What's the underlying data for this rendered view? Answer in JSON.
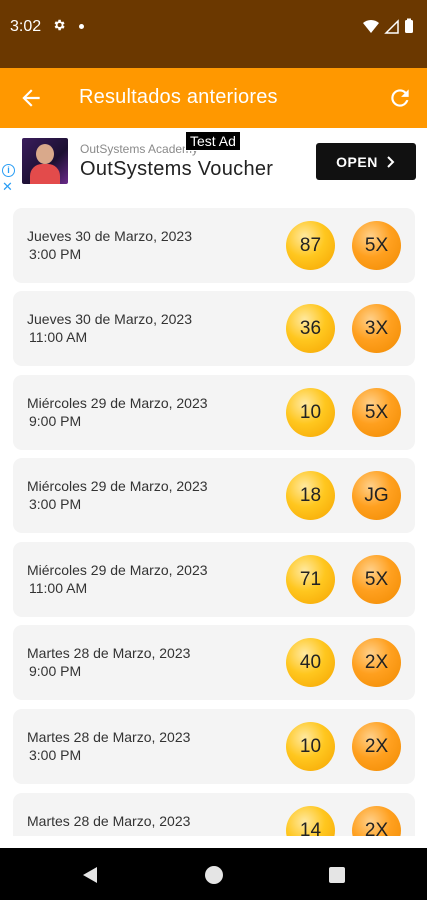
{
  "status_bar": {
    "time": "3:02",
    "icons": [
      "gear-icon",
      "notification-dot-icon",
      "wifi-icon",
      "signal-icon",
      "battery-icon"
    ]
  },
  "app_bar": {
    "title": "Resultados anteriores",
    "back_icon": "arrow-left-icon",
    "refresh_icon": "refresh-icon"
  },
  "ad": {
    "label": "Test Ad",
    "advertiser": "OutSystems Academy",
    "headline": "OutSystems Voucher",
    "cta": "OPEN",
    "cta_icon": "chevron-right-icon"
  },
  "results": [
    {
      "date": "Jueves 30 de Marzo, 2023",
      "time": "3:00 PM",
      "number": "87",
      "multiplier": "5X"
    },
    {
      "date": "Jueves 30 de Marzo, 2023",
      "time": "11:00 AM",
      "number": "36",
      "multiplier": "3X"
    },
    {
      "date": "Miércoles 29 de Marzo, 2023",
      "time": "9:00 PM",
      "number": "10",
      "multiplier": "5X"
    },
    {
      "date": "Miércoles 29 de Marzo, 2023",
      "time": "3:00 PM",
      "number": "18",
      "multiplier": "JG"
    },
    {
      "date": "Miércoles 29 de Marzo, 2023",
      "time": "11:00 AM",
      "number": "71",
      "multiplier": "5X"
    },
    {
      "date": "Martes 28 de Marzo, 2023",
      "time": "9:00 PM",
      "number": "40",
      "multiplier": "2X"
    },
    {
      "date": "Martes 28 de Marzo, 2023",
      "time": "3:00 PM",
      "number": "10",
      "multiplier": "2X"
    },
    {
      "date": "Martes 28 de Marzo, 2023",
      "time": "",
      "number": "14",
      "multiplier": "2X"
    }
  ],
  "colors": {
    "status_bar": "#6b3800",
    "app_bar": "#ff9800",
    "card": "#f4f4f4",
    "number_ball": "#ffc71f",
    "multiplier_ball": "#ffa01f"
  }
}
